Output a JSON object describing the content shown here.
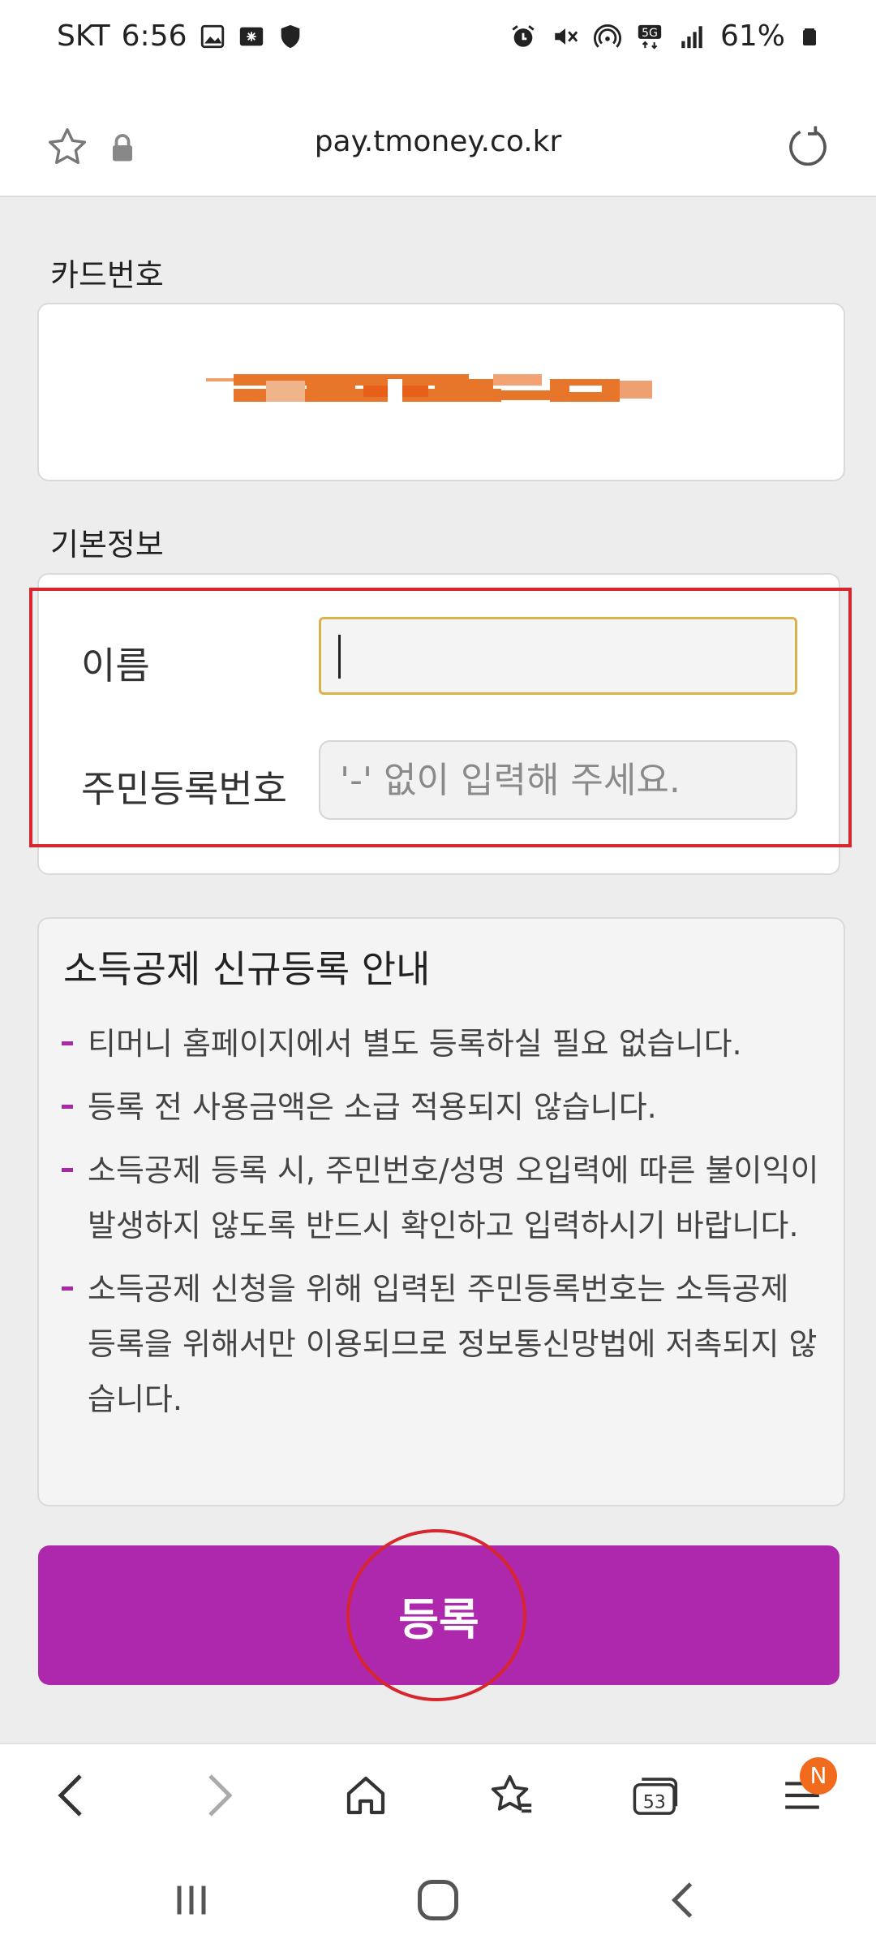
{
  "status_bar": {
    "carrier": "SKT",
    "time": "6:56",
    "network": "5G",
    "battery": "61%"
  },
  "browser": {
    "url": "pay.tmoney.co.kr",
    "tab_count": "53",
    "notification_badge": "N"
  },
  "card_section": {
    "label": "카드번호"
  },
  "basic_info": {
    "label": "기본정보",
    "name_label": "이름",
    "name_value": "",
    "resident_label": "주민등록번호",
    "resident_placeholder": "'-' 없이 입력해 주세요."
  },
  "notice": {
    "title": "소득공제 신규등록 안내",
    "items": [
      "티머니 홈페이지에서 별도 등록하실 필요 없습니다.",
      "등록 전 사용금액은 소급 적용되지 않습니다.",
      "소득공제 등록 시, 주민번호/성명 오입력에 따른 불이익이 발생하지 않도록 반드시 확인하고 입력하시기 바랍니다.",
      "소득공제 신청을 위해 입력된 주민등록번호는 소득공제 등록을 위해서만 이용되므로 정보통신망법에 저촉되지 않습니다."
    ]
  },
  "register_button": {
    "label": "등록"
  },
  "colors": {
    "accent": "#ad28ac",
    "highlight": "#d8262f",
    "badge": "#f26a1b",
    "card_pattern": "#e8762a"
  },
  "icons": {
    "status_left": [
      "gallery-icon",
      "keyboard-icon",
      "shield-icon"
    ],
    "status_right": [
      "alarm-icon",
      "mute-icon",
      "hotspot-icon",
      "5g-icon",
      "signal-icon",
      "battery-icon"
    ],
    "browser_nav": [
      "back-icon",
      "forward-icon",
      "home-icon",
      "bookmarks-icon",
      "tabs-icon",
      "menu-icon"
    ],
    "system_nav": [
      "recents-icon",
      "home-circle-icon",
      "system-back-icon"
    ]
  }
}
